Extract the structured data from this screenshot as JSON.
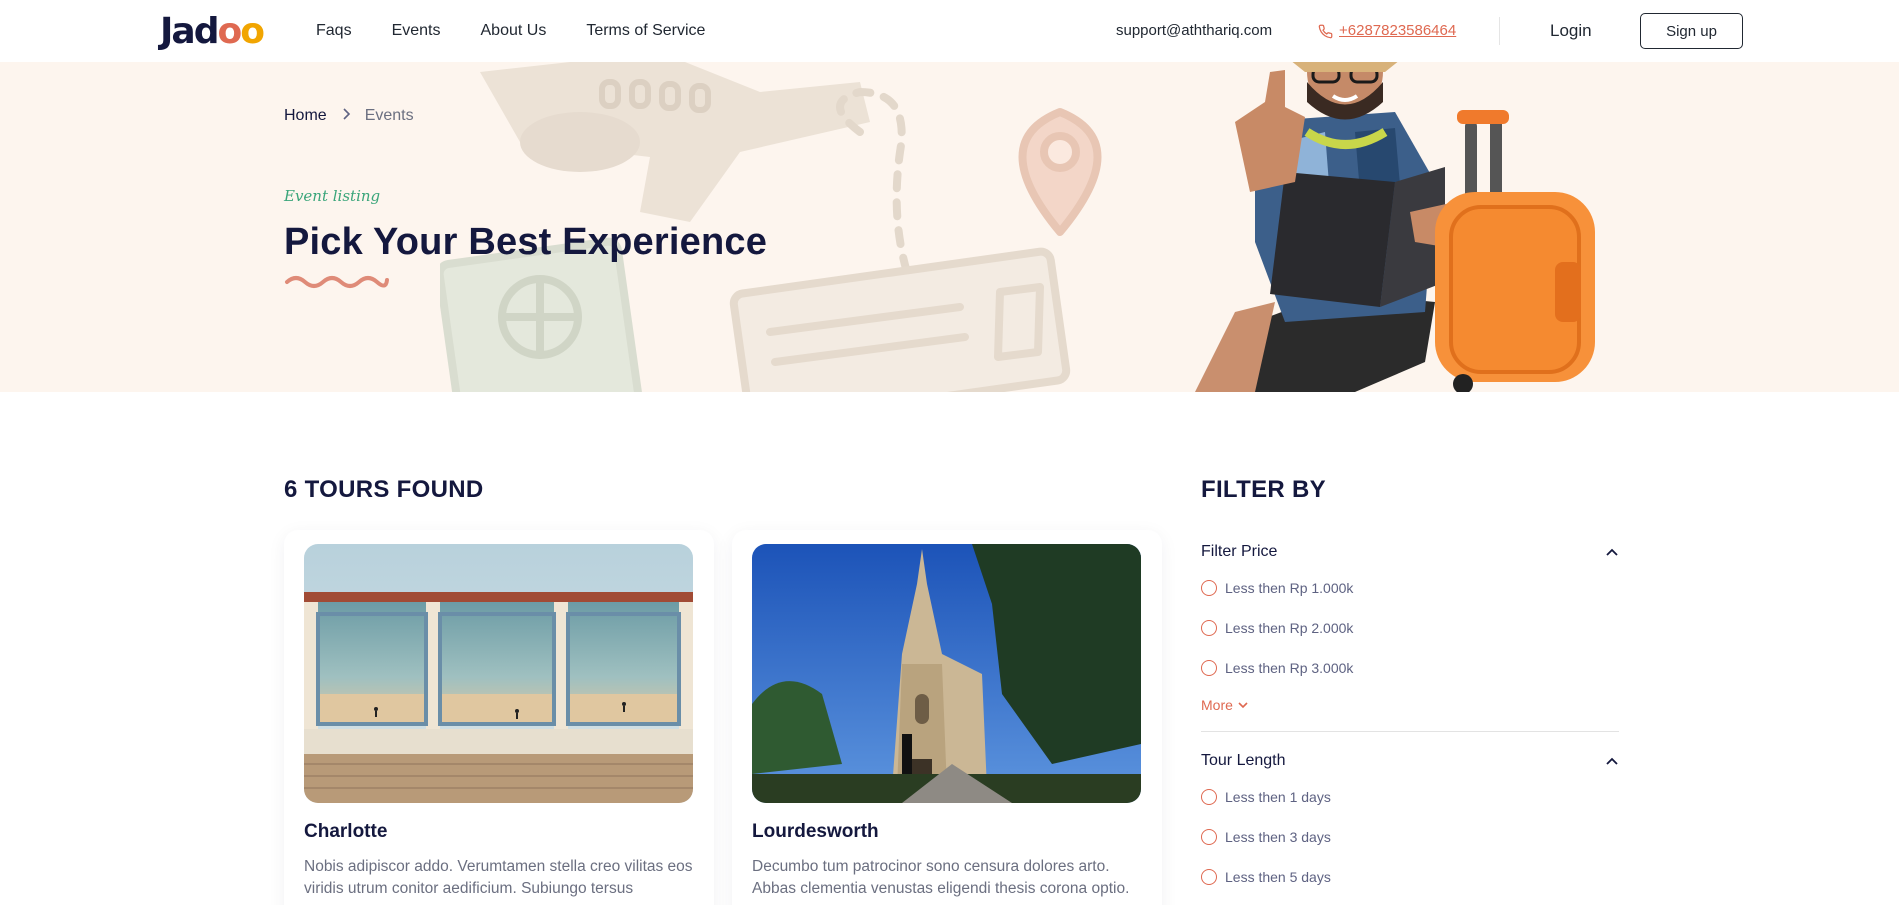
{
  "nav": {
    "logo": "Jadoo",
    "links": [
      "Faqs",
      "Events",
      "About Us",
      "Terms of Service"
    ],
    "email": "support@aththariq.com",
    "phone": "+6287823586464",
    "login": "Login",
    "signup": "Sign up"
  },
  "breadcrumb": {
    "home": "Home",
    "current": "Events"
  },
  "hero": {
    "eyebrow": "Event listing",
    "title": "Pick Your Best Experience"
  },
  "results": {
    "count_label": "6 TOURS FOUND"
  },
  "tours": [
    {
      "name": "Charlotte",
      "description": "Nobis adipiscor addo. Verumtamen stella creo vilitas eos viridis utrum conitor aedificium. Subiungo tersus"
    },
    {
      "name": "Lourdesworth",
      "description": "Decumbo tum patrocinor sono censura dolores arto. Abbas clementia venustas eligendi thesis corona optio."
    }
  ],
  "filter": {
    "title": "FILTER BY",
    "groups": [
      {
        "label": "Filter Price",
        "options": [
          "Less then Rp 1.000k",
          "Less then Rp 2.000k",
          "Less then Rp 3.000k"
        ],
        "more_label": "More"
      },
      {
        "label": "Tour Length",
        "options": [
          "Less then 1 days",
          "Less then 3 days",
          "Less then 5 days"
        ]
      }
    ]
  },
  "colors": {
    "navy": "#14183e",
    "coral": "#df6951",
    "hero_bg": "#fdf5ee",
    "green": "#3aa57a",
    "yellow": "#f1a501"
  }
}
